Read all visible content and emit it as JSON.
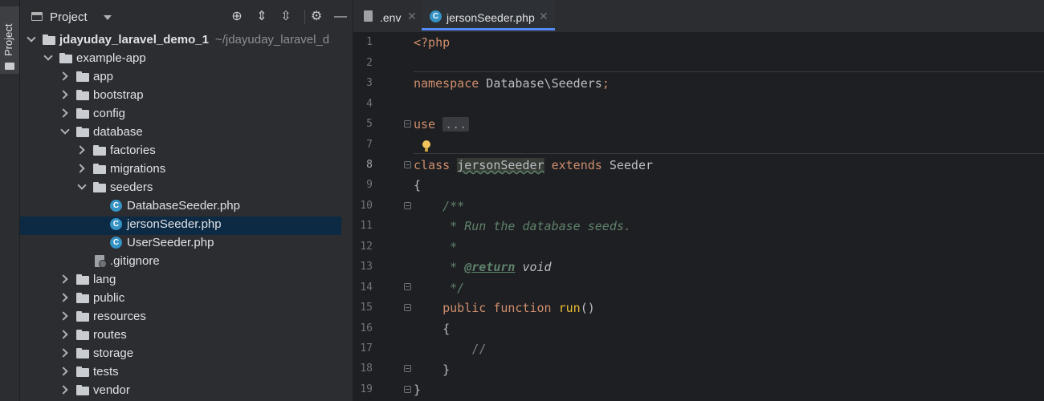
{
  "toolstrip": {
    "project_label": "Project"
  },
  "panel": {
    "title": "Project"
  },
  "tree": [
    {
      "label": "jdayuday_laravel_demo_1",
      "path": "~/jdayuday_laravel_d",
      "icon": "folder-icon",
      "expanded": true,
      "bold": true
    },
    {
      "label": "example-app",
      "icon": "folder-icon",
      "expanded": true
    },
    {
      "label": "app",
      "icon": "folder-icon",
      "expanded": false
    },
    {
      "label": "bootstrap",
      "icon": "folder-icon",
      "expanded": false
    },
    {
      "label": "config",
      "icon": "folder-icon",
      "expanded": false
    },
    {
      "label": "database",
      "icon": "folder-icon",
      "expanded": true
    },
    {
      "label": "factories",
      "icon": "folder-icon",
      "expanded": false
    },
    {
      "label": "migrations",
      "icon": "folder-icon",
      "expanded": false
    },
    {
      "label": "seeders",
      "icon": "folder-icon",
      "expanded": true
    },
    {
      "label": "DatabaseSeeder.php",
      "icon": "php-class-icon"
    },
    {
      "label": "jersonSeeder.php",
      "icon": "php-class-icon",
      "selected": true
    },
    {
      "label": "UserSeeder.php",
      "icon": "php-class-icon"
    },
    {
      "label": ".gitignore",
      "icon": "gitignore-icon"
    },
    {
      "label": "lang",
      "icon": "folder-icon",
      "expanded": false
    },
    {
      "label": "public",
      "icon": "folder-icon",
      "expanded": false
    },
    {
      "label": "resources",
      "icon": "folder-icon",
      "expanded": false
    },
    {
      "label": "routes",
      "icon": "folder-icon",
      "expanded": false
    },
    {
      "label": "storage",
      "icon": "folder-icon",
      "expanded": false
    },
    {
      "label": "tests",
      "icon": "folder-icon",
      "expanded": false
    },
    {
      "label": "vendor",
      "icon": "folder-icon",
      "expanded": false
    }
  ],
  "tabs": [
    {
      "label": ".env",
      "icon": "text-file-icon",
      "active": false
    },
    {
      "label": "jersonSeeder.php",
      "icon": "php-class-icon",
      "active": true
    }
  ],
  "editor": {
    "line_numbers": [
      "1",
      "2",
      "3",
      "4",
      "5",
      "7",
      "8",
      "9",
      "10",
      "11",
      "12",
      "13",
      "14",
      "15",
      "16",
      "17",
      "18",
      "19"
    ],
    "current_line": "8",
    "lines": {
      "l1": "<?php",
      "l3_kw": "namespace",
      "l3_ns": " Database\\Seeders",
      "l3_semi": ";",
      "l5_kw": "use",
      "l5_fold": "...",
      "l8_kw": "class",
      "l8_name": "jersonSeeder",
      "l8_ext": "extends",
      "l8_parent": "Seeder",
      "l9": "{",
      "l10": "    /**",
      "l11": "     * Run the database seeds.",
      "l12": "     *",
      "l13_pre": "     * ",
      "l13_tag": "@return",
      "l13_post": " void",
      "l14": "     */",
      "l15_kw": "    public function",
      "l15_fn": " run",
      "l15_rest": "()",
      "l16": "    {",
      "l17": "        //",
      "l18": "    }",
      "l19": "}"
    }
  },
  "colors": {
    "selection": "#0d2a44",
    "accent": "#548af7",
    "keyword": "#cf8e6d",
    "doc_comment": "#5f826b",
    "php_class_icon": "#3592c4"
  }
}
